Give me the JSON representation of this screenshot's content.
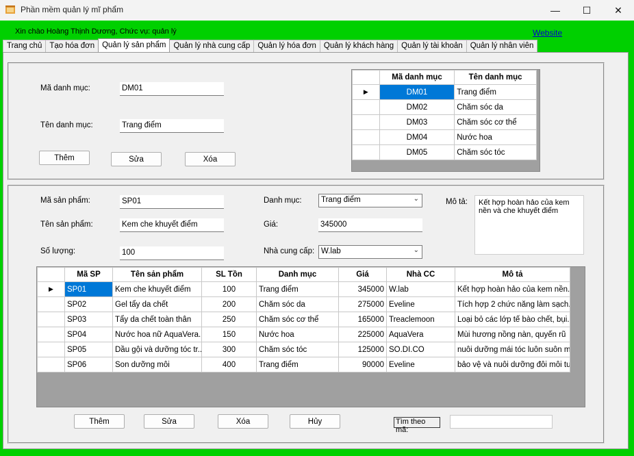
{
  "window": {
    "title": "Phần mềm quản lý mĩ phẩm",
    "minimize": "—",
    "maximize": "☐",
    "close": "✕"
  },
  "greeting": "Xin chào Hoàng Thịnh Dương, Chức vụ: quản lý",
  "website_link": "Website",
  "tabs": [
    "Trang chủ",
    "Tạo hóa đơn",
    "Quản lý sản phẩm",
    "Quản lý nhà cung cấp",
    "Quản lý hóa đơn",
    "Quản lý khách hàng",
    "Quản lý tài khoản",
    "Quản lý nhân viên"
  ],
  "active_tab": "Quản lý sản phẩm",
  "category": {
    "ma_label": "Mã danh mục:",
    "ma_value": "DM01",
    "ten_label": "Tên danh mục:",
    "ten_value": "Trang điểm",
    "btn_add": "Thêm",
    "btn_edit": "Sửa",
    "btn_delete": "Xóa",
    "grid": {
      "headers": [
        "Mã danh mục",
        "Tên danh mục"
      ],
      "rows": [
        [
          "DM01",
          "Trang điểm"
        ],
        [
          "DM02",
          "Chăm sóc da"
        ],
        [
          "DM03",
          "Chăm sóc cơ thể"
        ],
        [
          "DM04",
          "Nước hoa"
        ],
        [
          "DM05",
          "Chăm sóc tóc"
        ]
      ]
    }
  },
  "product": {
    "ma_label": "Mã sản phẩm:",
    "ma_value": "SP01",
    "ten_label": "Tên sản phẩm:",
    "ten_value": "Kem che khuyết điểm",
    "sl_label": "Số lượng:",
    "sl_value": "100",
    "dm_label": "Danh mục:",
    "dm_value": "Trang điểm",
    "gia_label": "Giá:",
    "gia_value": "345000",
    "ncc_label": "Nhà cung cấp:",
    "ncc_value": "W.lab",
    "mota_label": "Mô tả:",
    "mota_value": "Kết hợp hoàn hảo của kem nền và che khuyết điểm",
    "grid": {
      "headers": [
        "Mã SP",
        "Tên sản phẩm",
        "SL Tồn",
        "Danh mục",
        "Giá",
        "Nhà CC",
        "Mô tả"
      ],
      "rows": [
        [
          "SP01",
          "Kem che khuyết điểm",
          "100",
          "Trang điểm",
          "345000",
          "W.lab",
          "Kết hợp hoàn hảo của kem nền..."
        ],
        [
          "SP02",
          "Gel tẩy da chết",
          "200",
          "Chăm sóc da",
          "275000",
          "Eveline",
          "Tích hợp 2 chức năng làm sạch..."
        ],
        [
          "SP03",
          "Tẩy da chết toàn thân",
          "250",
          "Chăm sóc cơ thể",
          "165000",
          "Treaclemoon",
          "Loại bỏ các lớp tế bào chết, bụi..."
        ],
        [
          "SP04",
          "Nước hoa nữ AquaVera...",
          "150",
          "Nước hoa",
          "225000",
          "AquaVera",
          "Mùi hương nồng nàn, quyến rũ"
        ],
        [
          "SP05",
          "Dầu gội và dưỡng tóc tr...",
          "300",
          "Chăm sóc tóc",
          "125000",
          "SO.DI.CO",
          "nuôi dưỡng mái tóc luôn suôn m..."
        ],
        [
          "SP06",
          "Son dưỡng môi",
          "400",
          "Trang điểm",
          "90000",
          "Eveline",
          "bảo vệ và nuôi dưỡng đôi môi tư..."
        ]
      ]
    },
    "btn_add": "Thêm",
    "btn_edit": "Sửa",
    "btn_delete": "Xóa",
    "btn_cancel": "Hủy",
    "search_label": "Tìm theo mã:",
    "search_value": ""
  },
  "row_marker": "▶",
  "combo_caret": "⌄"
}
